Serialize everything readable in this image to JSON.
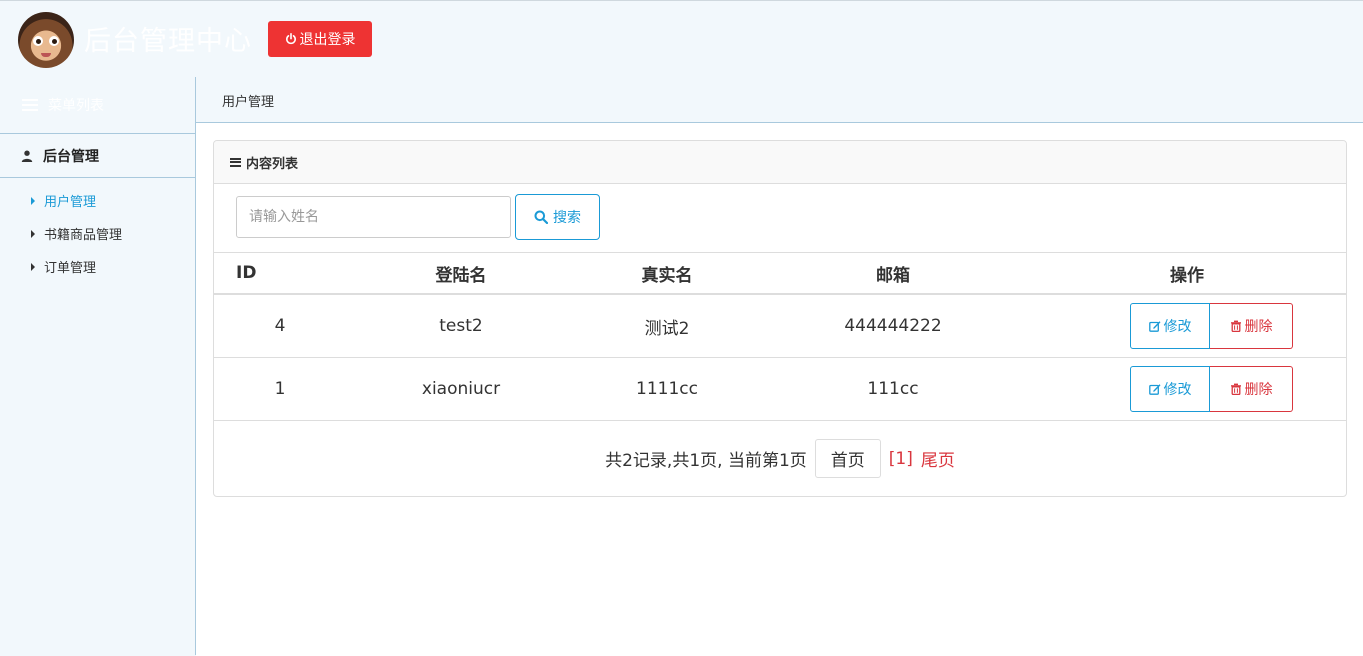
{
  "header": {
    "title": "后台管理中心",
    "logout_label": "退出登录"
  },
  "sidebar": {
    "menu_title": "菜单列表",
    "group_label": "后台管理",
    "items": [
      {
        "label": "用户管理",
        "active": true
      },
      {
        "label": "书籍商品管理",
        "active": false
      },
      {
        "label": "订单管理",
        "active": false
      }
    ]
  },
  "breadcrumb": "用户管理",
  "panel": {
    "title": "内容列表",
    "search": {
      "placeholder": "请输入姓名",
      "value": "",
      "button_label": "搜索"
    }
  },
  "table": {
    "headers": [
      "ID",
      "登陆名",
      "真实名",
      "邮箱",
      "操作"
    ],
    "rows": [
      {
        "id": "4",
        "login": "test2",
        "real": "测试2",
        "email": "444444222"
      },
      {
        "id": "1",
        "login": "xiaoniucr",
        "real": "1111cc",
        "email": "111cc"
      }
    ],
    "edit_label": "修改",
    "delete_label": "删除"
  },
  "pager": {
    "summary": "共2记录,共1页, 当前第1页",
    "first_label": "首页",
    "current": "[1]",
    "last_label": "尾页"
  },
  "colors": {
    "accent": "#1a9ad6",
    "danger": "#d9363e",
    "logout": "#ee3333",
    "background": "#f2f8fc"
  }
}
